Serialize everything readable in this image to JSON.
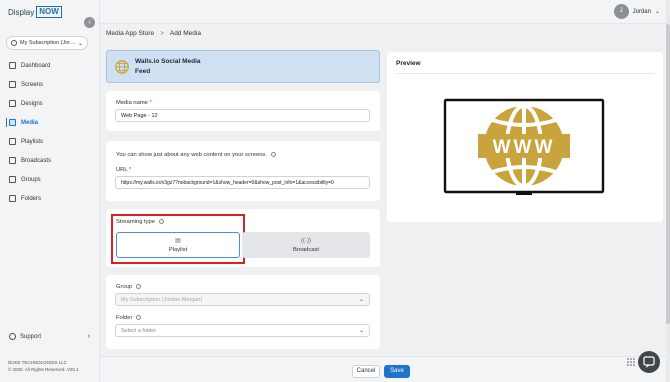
{
  "brand": {
    "name": "Display",
    "highlight": "NOW"
  },
  "sidebar": {
    "subscription": "My Subscription (Jor…",
    "items": [
      {
        "label": "Dashboard",
        "icon": "dashboard-icon"
      },
      {
        "label": "Screens",
        "icon": "screen-icon"
      },
      {
        "label": "Designs",
        "icon": "design-icon"
      },
      {
        "label": "Media",
        "icon": "media-icon",
        "active": true
      },
      {
        "label": "Playlists",
        "icon": "playlist-icon"
      },
      {
        "label": "Broadcasts",
        "icon": "broadcast-icon"
      },
      {
        "label": "Groups",
        "icon": "groups-icon"
      },
      {
        "label": "Folders",
        "icon": "folder-icon"
      }
    ],
    "support": "Support",
    "footer_company": "DUKE TECHNOLOGIES LLC",
    "footer_copyright": "© 2025. All Rights Reserved. V25.1"
  },
  "header": {
    "user_initial": "J",
    "user_name": "Jordan"
  },
  "breadcrumb": {
    "parent": "Media App Store",
    "separator": ">",
    "current": "Add Media"
  },
  "app": {
    "title_line1": "Walls.io Social Media",
    "title_line2": "Feed"
  },
  "form": {
    "media_name_label": "Media name",
    "media_name_value": "Web Page - 12",
    "info_text": "You can show just about any web content on your screens.",
    "url_label": "URL",
    "url_value": "https://my.walls.io/n3gz7?nobackground=1&show_header=0&show_post_info=1&accessibility=0",
    "streaming_label": "Streaming type",
    "streaming_options": [
      "Playlist",
      "Broadcast"
    ],
    "group_label": "Group",
    "group_value": "My Subscription (Jordan Morgan)",
    "folder_label": "Folder",
    "folder_placeholder": "Select a folder"
  },
  "preview": {
    "title": "Preview",
    "www_text": "WWW"
  },
  "actions": {
    "cancel": "Cancel",
    "save": "Save"
  },
  "colors": {
    "accent": "#1f73c8",
    "highlight_border": "#d9221f",
    "globe_gold": "#c9a33c"
  }
}
